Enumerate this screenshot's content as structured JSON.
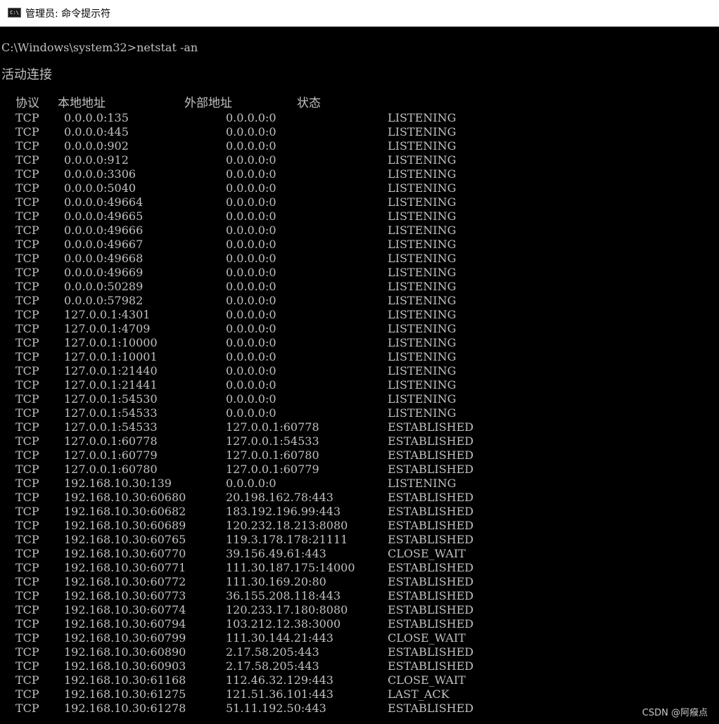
{
  "window": {
    "title": "管理员: 命令提示符",
    "icon": "cmd-icon"
  },
  "console": {
    "prompt": "C:\\Windows\\system32>netstat -an",
    "section_title": "活动连接",
    "headers": [
      "协议",
      "本地地址",
      "外部地址",
      "状态"
    ],
    "rows": [
      [
        "TCP",
        "0.0.0.0:135",
        "0.0.0.0:0",
        "LISTENING"
      ],
      [
        "TCP",
        "0.0.0.0:445",
        "0.0.0.0:0",
        "LISTENING"
      ],
      [
        "TCP",
        "0.0.0.0:902",
        "0.0.0.0:0",
        "LISTENING"
      ],
      [
        "TCP",
        "0.0.0.0:912",
        "0.0.0.0:0",
        "LISTENING"
      ],
      [
        "TCP",
        "0.0.0.0:3306",
        "0.0.0.0:0",
        "LISTENING"
      ],
      [
        "TCP",
        "0.0.0.0:5040",
        "0.0.0.0:0",
        "LISTENING"
      ],
      [
        "TCP",
        "0.0.0.0:49664",
        "0.0.0.0:0",
        "LISTENING"
      ],
      [
        "TCP",
        "0.0.0.0:49665",
        "0.0.0.0:0",
        "LISTENING"
      ],
      [
        "TCP",
        "0.0.0.0:49666",
        "0.0.0.0:0",
        "LISTENING"
      ],
      [
        "TCP",
        "0.0.0.0:49667",
        "0.0.0.0:0",
        "LISTENING"
      ],
      [
        "TCP",
        "0.0.0.0:49668",
        "0.0.0.0:0",
        "LISTENING"
      ],
      [
        "TCP",
        "0.0.0.0:49669",
        "0.0.0.0:0",
        "LISTENING"
      ],
      [
        "TCP",
        "0.0.0.0:50289",
        "0.0.0.0:0",
        "LISTENING"
      ],
      [
        "TCP",
        "0.0.0.0:57982",
        "0.0.0.0:0",
        "LISTENING"
      ],
      [
        "TCP",
        "127.0.0.1:4301",
        "0.0.0.0:0",
        "LISTENING"
      ],
      [
        "TCP",
        "127.0.0.1:4709",
        "0.0.0.0:0",
        "LISTENING"
      ],
      [
        "TCP",
        "127.0.0.1:10000",
        "0.0.0.0:0",
        "LISTENING"
      ],
      [
        "TCP",
        "127.0.0.1:10001",
        "0.0.0.0:0",
        "LISTENING"
      ],
      [
        "TCP",
        "127.0.0.1:21440",
        "0.0.0.0:0",
        "LISTENING"
      ],
      [
        "TCP",
        "127.0.0.1:21441",
        "0.0.0.0:0",
        "LISTENING"
      ],
      [
        "TCP",
        "127.0.0.1:54530",
        "0.0.0.0:0",
        "LISTENING"
      ],
      [
        "TCP",
        "127.0.0.1:54533",
        "0.0.0.0:0",
        "LISTENING"
      ],
      [
        "TCP",
        "127.0.0.1:54533",
        "127.0.0.1:60778",
        "ESTABLISHED"
      ],
      [
        "TCP",
        "127.0.0.1:60778",
        "127.0.0.1:54533",
        "ESTABLISHED"
      ],
      [
        "TCP",
        "127.0.0.1:60779",
        "127.0.0.1:60780",
        "ESTABLISHED"
      ],
      [
        "TCP",
        "127.0.0.1:60780",
        "127.0.0.1:60779",
        "ESTABLISHED"
      ],
      [
        "TCP",
        "192.168.10.30:139",
        "0.0.0.0:0",
        "LISTENING"
      ],
      [
        "TCP",
        "192.168.10.30:60680",
        "20.198.162.78:443",
        "ESTABLISHED"
      ],
      [
        "TCP",
        "192.168.10.30:60682",
        "183.192.196.99:443",
        "ESTABLISHED"
      ],
      [
        "TCP",
        "192.168.10.30:60689",
        "120.232.18.213:8080",
        "ESTABLISHED"
      ],
      [
        "TCP",
        "192.168.10.30:60765",
        "119.3.178.178:21111",
        "ESTABLISHED"
      ],
      [
        "TCP",
        "192.168.10.30:60770",
        "39.156.49.61:443",
        "CLOSE_WAIT"
      ],
      [
        "TCP",
        "192.168.10.30:60771",
        "111.30.187.175:14000",
        "ESTABLISHED"
      ],
      [
        "TCP",
        "192.168.10.30:60772",
        "111.30.169.20:80",
        "ESTABLISHED"
      ],
      [
        "TCP",
        "192.168.10.30:60773",
        "36.155.208.118:443",
        "ESTABLISHED"
      ],
      [
        "TCP",
        "192.168.10.30:60774",
        "120.233.17.180:8080",
        "ESTABLISHED"
      ],
      [
        "TCP",
        "192.168.10.30:60794",
        "103.212.12.38:3000",
        "ESTABLISHED"
      ],
      [
        "TCP",
        "192.168.10.30:60799",
        "111.30.144.21:443",
        "CLOSE_WAIT"
      ],
      [
        "TCP",
        "192.168.10.30:60890",
        "2.17.58.205:443",
        "ESTABLISHED"
      ],
      [
        "TCP",
        "192.168.10.30:60903",
        "2.17.58.205:443",
        "ESTABLISHED"
      ],
      [
        "TCP",
        "192.168.10.30:61168",
        "112.46.32.129:443",
        "CLOSE_WAIT"
      ],
      [
        "TCP",
        "192.168.10.30:61275",
        "121.51.36.101:443",
        "LAST_ACK"
      ],
      [
        "TCP",
        "192.168.10.30:61278",
        "51.11.192.50:443",
        "ESTABLISHED"
      ]
    ]
  },
  "watermark": "CSDN @阿瘊点",
  "colors": {
    "background": "#000000",
    "text": "#c0c0c0",
    "titlebar": "#ffffff"
  }
}
